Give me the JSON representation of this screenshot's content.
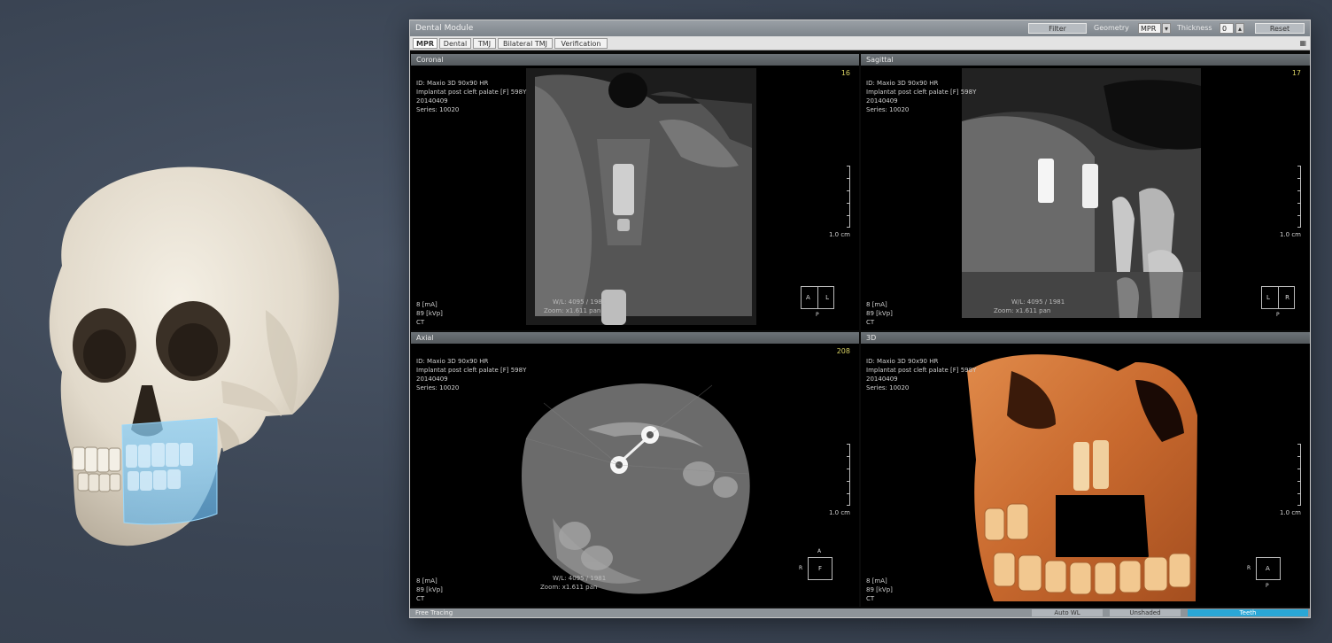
{
  "window": {
    "title": "Dental Module",
    "toolbar": {
      "filter_label": "Filter",
      "geometry_label": "Geometry",
      "geometry_value": "MPR",
      "thickness_label": "Thickness",
      "thickness_value": "0",
      "reset_label": "Reset"
    },
    "tabs": [
      "MPR",
      "Dental",
      "TMJ",
      "Bilateral TMJ",
      "Verification"
    ],
    "active_tab": "MPR"
  },
  "viewports": {
    "coronal": {
      "title": "Coronal",
      "slice": "16",
      "info": [
        "ID: Maxio 3D 90x90 HR",
        "Implantat post cleft palate [F] 598Y",
        "20140409",
        "Series: 10020"
      ],
      "bottom": [
        "8 [mA]",
        "89 [kVp]",
        "CT"
      ],
      "scale": "1.0 cm",
      "orientation": {
        "left": "A",
        "right": "L",
        "bottom": "P"
      },
      "wl": "W/L: 4095 / 1981",
      "zoom": "Zoom: x1.611 pan"
    },
    "sagittal": {
      "title": "Sagittal",
      "slice": "17",
      "info": [
        "ID: Maxio 3D 90x90 HR",
        "Implantat post cleft palate [F] 598Y",
        "20140409",
        "Series: 10020"
      ],
      "bottom": [
        "8 [mA]",
        "89 [kVp]",
        "CT"
      ],
      "scale": "1.0 cm",
      "orientation": {
        "left": "L",
        "right": "R",
        "bottom": "P"
      },
      "wl": "W/L: 4095 / 1981",
      "zoom": "Zoom: x1.611 pan"
    },
    "axial": {
      "title": "Axial",
      "slice": "208",
      "info": [
        "ID: Maxio 3D 90x90 HR",
        "Implantat post cleft palate [F] 598Y",
        "20140409",
        "Series: 10020"
      ],
      "bottom": [
        "8 [mA]",
        "89 [kVp]",
        "CT"
      ],
      "scale": "1.0 cm",
      "orientation": {
        "top": "A",
        "left": "R",
        "center": "F"
      },
      "wl": "W/L: 4095 / 1981",
      "zoom": "Zoom: x1.611 pan"
    },
    "threed": {
      "title": "3D",
      "info": [
        "ID: Maxio 3D 90x90 HR",
        "Implantat post cleft palate [F] 598Y",
        "20140409",
        "Series: 10020"
      ],
      "bottom": [
        "8 [mA]",
        "89 [kVp]",
        "CT"
      ],
      "scale": "1.0 cm",
      "orientation": {
        "left": "R",
        "center": "A",
        "bottom": "P"
      }
    }
  },
  "statusbar": {
    "left": "Free Tracing",
    "buttons": [
      "Auto WL",
      "Unshaded",
      "Teeth"
    ]
  },
  "colors": {
    "accent": "#2aa7d6",
    "slice_number": "#d6cf62",
    "background": "#3a4453",
    "render_3d": "#c8692e"
  }
}
